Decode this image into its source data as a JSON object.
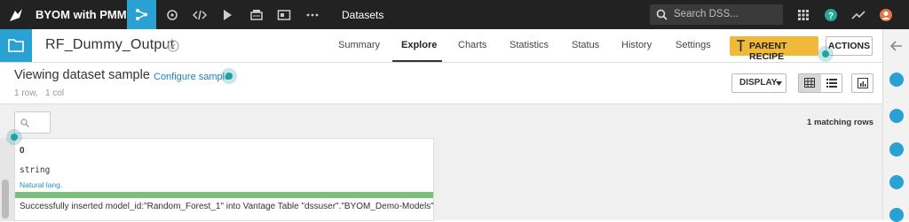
{
  "topbar": {
    "project_name": "BYOM with PMML",
    "section_title": "Datasets",
    "search_placeholder": "Search DSS...",
    "icons": [
      "bird-logo-icon",
      "flow-icon",
      "recipes-icon",
      "code-icon",
      "play-icon",
      "jobs-icon",
      "dashboard-icon",
      "more-icon",
      "apps-grid-icon",
      "help-icon",
      "activity-icon",
      "user-avatar-icon"
    ]
  },
  "dataset": {
    "name": "RF_Dummy_Output"
  },
  "tabs": [
    {
      "label": "Summary",
      "active": false
    },
    {
      "label": "Explore",
      "active": true
    },
    {
      "label": "Charts",
      "active": false
    },
    {
      "label": "Statistics",
      "active": false
    },
    {
      "label": "Status",
      "active": false
    },
    {
      "label": "History",
      "active": false
    },
    {
      "label": "Settings",
      "active": false
    }
  ],
  "buttons": {
    "parent_recipe": "PARENT RECIPE",
    "actions": "ACTIONS",
    "display": "DISPLAY"
  },
  "sample": {
    "title": "Viewing dataset sample",
    "configure": "Configure sample",
    "rows_count": "1",
    "rows_label": "row,",
    "cols_count": "1",
    "cols_label": "col"
  },
  "grid": {
    "matching": "1 matching rows",
    "column": {
      "name": "0",
      "type": "string",
      "meaning": "Natural lang.",
      "value": "Successfully inserted model_id:\"Random_Forest_1\" into Vantage Table \"dssuser\".\"BYOM_Demo-Models\""
    }
  },
  "colors": {
    "topbar_bg": "#222222",
    "accent_blue": "#2aa1d3",
    "parent_recipe_yellow": "#f1b93a",
    "valid_bar_green": "#79c07c",
    "hint_dot_teal": "#1ea3a6"
  }
}
